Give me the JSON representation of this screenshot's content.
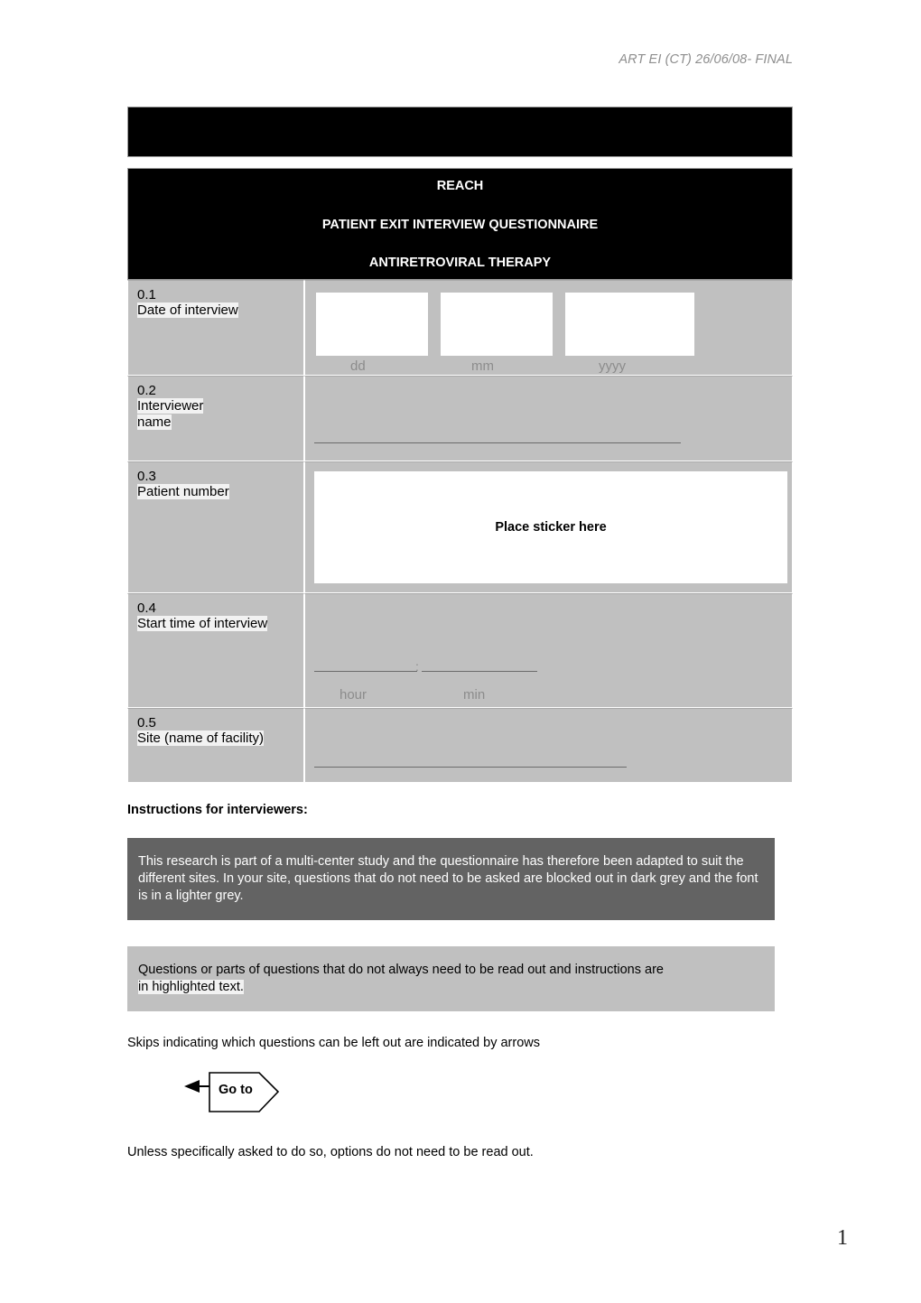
{
  "document": {
    "running_header": "ART EI (CT) 26/06/08- FINAL",
    "page_number": "1"
  },
  "title_block": {
    "line1": "REACH",
    "line2": "PATIENT EXIT INTERVIEW QUESTIONNAIRE",
    "line3": "ANTIRETROVIRAL THERAPY"
  },
  "form": {
    "rows": [
      {
        "number": "0.1",
        "label": "Date of interview",
        "captions": {
          "day": "dd",
          "month": "mm",
          "year": "yyyy"
        }
      },
      {
        "number": "0.2",
        "label_line1": "Interviewer",
        "label_line2": "name"
      },
      {
        "number": "0.3",
        "label": "Patient number",
        "sticker_text": "Place sticker here"
      },
      {
        "number": "0.4",
        "label": "Start time of interview",
        "separator": ":",
        "captions": {
          "hour": "hour",
          "min": "min"
        }
      },
      {
        "number": "0.5",
        "label": "Site (name of facility)"
      }
    ]
  },
  "instructions": {
    "heading": "Instructions for interviewers:",
    "dark_box": "This research is part of a multi-center study and the questionnaire has therefore been adapted to suit the different sites. In your site, questions that do not need to be asked are blocked out in dark grey and the font is in a lighter grey.",
    "light_box_part1": "Questions or parts of questions that do not always need to be read out and instructions are",
    "light_box_highlight": "in highlighted text.",
    "skips_note": "Skips indicating which questions can be left out are indicated by arrows",
    "goto_label": "Go to",
    "options_note": "Unless specifically asked to do so, options do not need to be read out."
  },
  "colors": {
    "cell_gray": "#c0c0c0",
    "instruction_dark_gray": "#636363",
    "black": "#000000",
    "highlight": "#f2f2f2",
    "muted_text": "#8c8c8c"
  }
}
